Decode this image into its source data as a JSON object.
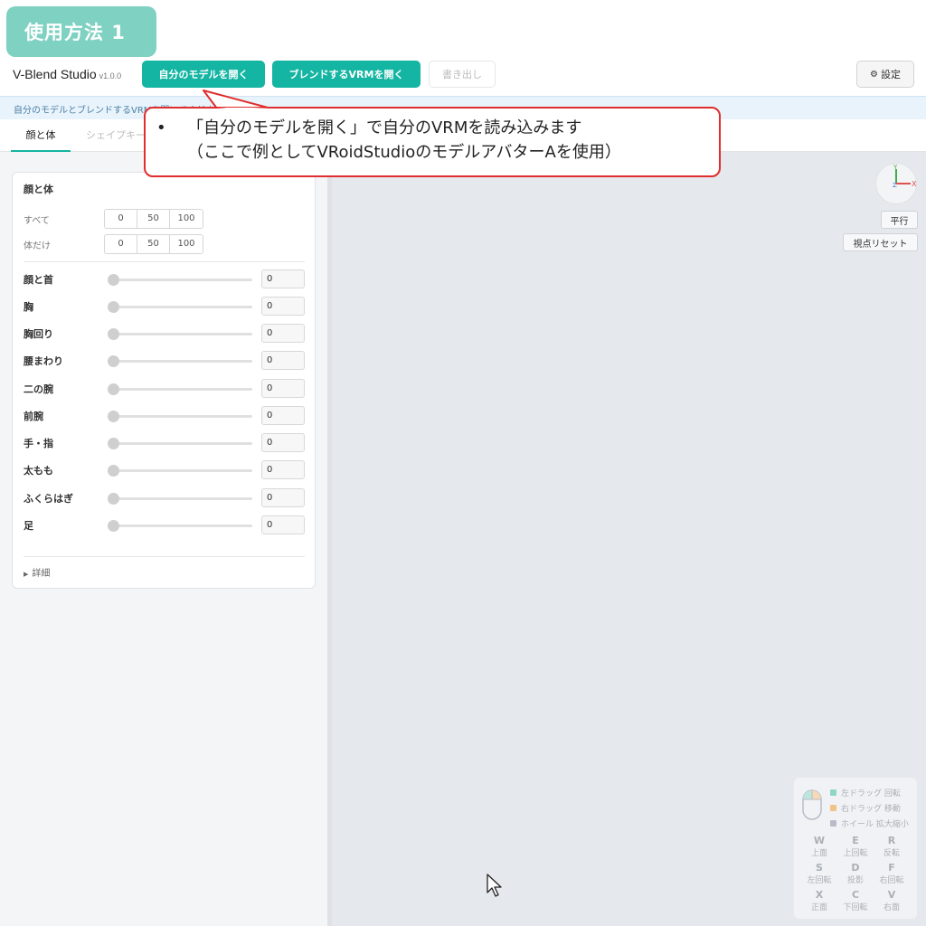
{
  "slide_badge": "使用方法 1",
  "toolbar": {
    "app_name": "V-Blend Studio",
    "version": "v1.0.0",
    "open_model": "自分のモデルを開く",
    "open_blend": "ブレンドするVRMを開く",
    "export": "書き出し",
    "settings_icon": "⚙",
    "settings": "設定"
  },
  "hint": "自分のモデルとブレンドするVRMを開いてください",
  "tabs": [
    "顔と体",
    "シェイプキー"
  ],
  "panel": {
    "title": "顔と体",
    "presets": [
      {
        "label": "すべて",
        "options": [
          "0",
          "50",
          "100"
        ]
      },
      {
        "label": "体だけ",
        "options": [
          "0",
          "50",
          "100"
        ]
      }
    ],
    "sliders": [
      {
        "label": "顔と首",
        "value": "0"
      },
      {
        "label": "胸",
        "value": "0"
      },
      {
        "label": "胸回り",
        "value": "0"
      },
      {
        "label": "腰まわり",
        "value": "0"
      },
      {
        "label": "二の腕",
        "value": "0"
      },
      {
        "label": "前腕",
        "value": "0"
      },
      {
        "label": "手・指",
        "value": "0"
      },
      {
        "label": "太もも",
        "value": "0"
      },
      {
        "label": "ふくらはぎ",
        "value": "0"
      },
      {
        "label": "足",
        "value": "0"
      }
    ],
    "details": "詳細"
  },
  "viewport": {
    "axes": {
      "y": "Y",
      "x": "X",
      "z": "Z"
    },
    "parallel_button": "平行",
    "reset_view_button": "視点リセット",
    "mouse_help": [
      {
        "color": "#8fd6c8",
        "text": "左ドラッグ 回転"
      },
      {
        "color": "#f2c28b",
        "text": "右ドラッグ 移動"
      },
      {
        "color": "#b9bcc8",
        "text": "ホイール 拡大縮小"
      }
    ],
    "keys": [
      {
        "key": "W",
        "desc": "上面"
      },
      {
        "key": "E",
        "desc": "上回転"
      },
      {
        "key": "R",
        "desc": "反転"
      },
      {
        "key": "S",
        "desc": "左回転"
      },
      {
        "key": "D",
        "desc": "投影"
      },
      {
        "key": "F",
        "desc": "右回転"
      },
      {
        "key": "X",
        "desc": "正面"
      },
      {
        "key": "C",
        "desc": "下回転"
      },
      {
        "key": "V",
        "desc": "右面"
      }
    ]
  },
  "callout": {
    "bullet": "•",
    "line1": "「自分のモデルを開く」で自分のVRMを読み込みます",
    "line2": "（ここで例としてVRoidStudioのモデルアバターAを使用）"
  }
}
